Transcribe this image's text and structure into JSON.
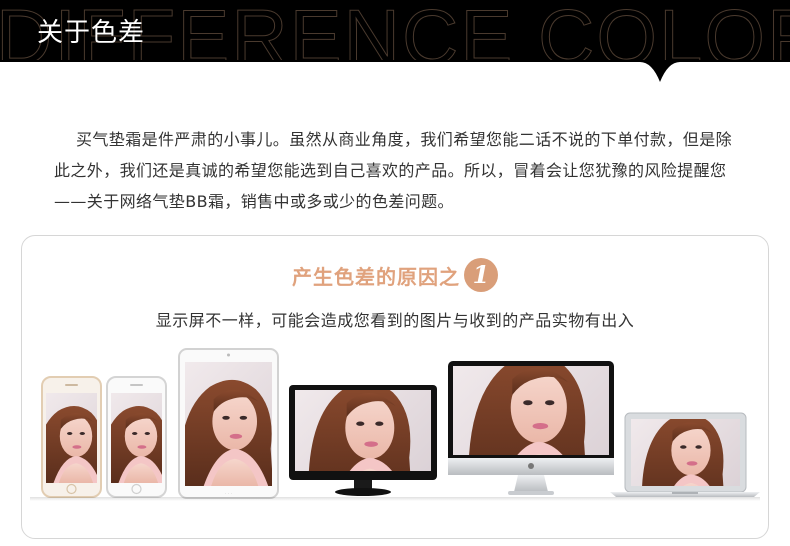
{
  "header": {
    "title": "关于色差",
    "watermark": "DIFFERENCE COLOR",
    "colors": {
      "bar": "#000000",
      "watermark_stroke": "#4a3a2e"
    }
  },
  "intro": {
    "text": "买气垫霜是件严肃的小事儿。虽然从商业角度，我们希望您能二话不说的下单付款，但是除此之外，我们还是真诚的希望您能选到自己喜欢的产品。所以，冒着会让您犹豫的风险提醒您——关于网络气垫BB霜，销售中或多或少的色差问题。"
  },
  "reason": {
    "title": "产生色差的原因之",
    "number": "1",
    "description": "显示屏不一样，可能会造成您看到的图片与收到的产品实物有出入",
    "accent_color": "#e0a27d"
  },
  "devices": [
    {
      "name": "iphone-gold",
      "icon": "smartphone-icon"
    },
    {
      "name": "iphone-white",
      "icon": "smartphone-icon"
    },
    {
      "name": "ipad-white",
      "icon": "tablet-icon"
    },
    {
      "name": "dell-monitor",
      "icon": "monitor-icon"
    },
    {
      "name": "imac",
      "icon": "desktop-icon"
    },
    {
      "name": "macbook",
      "icon": "laptop-icon"
    }
  ]
}
